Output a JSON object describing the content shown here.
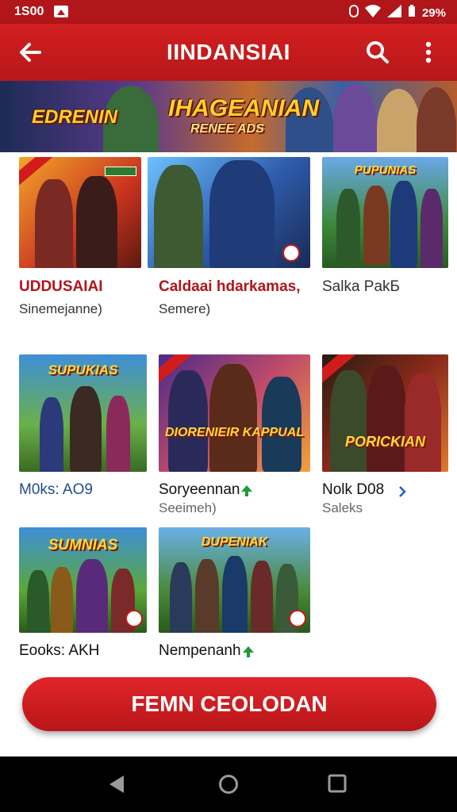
{
  "status_bar": {
    "time": "1S00",
    "right_icons": [
      "alarm-icon",
      "wifi-icon",
      "signal-icon",
      "battery-icon"
    ],
    "battery_text": "29%"
  },
  "app_bar": {
    "title": "IINDANSIAI",
    "back_icon": "arrow-left-icon",
    "search_icon": "search-icon",
    "more_icon": "more-vertical-icon"
  },
  "hero": {
    "logo_left": "EDRENIN",
    "logo_main": "IHAGEANIAN",
    "logo_sub": "RENEE ADS"
  },
  "games": [
    {
      "title": "UDDUSAIAI",
      "title_color": "#b3141a",
      "subtitle": "Sinemejanne)",
      "logo": ""
    },
    {
      "title": "Caldaai hdarkamas,",
      "title_color": "#b3141a",
      "subtitle": "Semere)",
      "logo": ""
    },
    {
      "title": "Salka PakБ",
      "title_color": "#333333",
      "subtitle": "",
      "logo": "PUPUNIAS"
    },
    {
      "title": "M0ks: AO9",
      "title_color": "#1f4e8c",
      "subtitle": "",
      "logo": "SUPUKIAS"
    },
    {
      "title": "Soryeennan",
      "title_color": "#111111",
      "subtitle": "Seeimeh)",
      "logo": "DIORENIEIR KAPPUAL",
      "indicator": "up-arrow"
    },
    {
      "title": "Nolk D08",
      "title_color": "#111111",
      "subtitle": "Saleks",
      "logo": "PORICKIAN",
      "indicator": "chevron"
    },
    {
      "title": "Eooks: AKH",
      "title_color": "#111111",
      "subtitle": "",
      "logo": "SUMNIAS"
    },
    {
      "title": "Nempenanh",
      "title_color": "#111111",
      "subtitle": "",
      "logo": "DUPENIAK",
      "indicator": "up-arrow"
    }
  ],
  "cta": {
    "label": "FEMN CEOLODAN"
  },
  "nav_bar": {
    "icons": [
      "back-triangle-icon",
      "home-circle-icon",
      "recents-square-icon"
    ]
  },
  "colors": {
    "primary": "#c8191d",
    "accent_green": "#1f9a3a",
    "accent_blue": "#1e5fc9"
  }
}
